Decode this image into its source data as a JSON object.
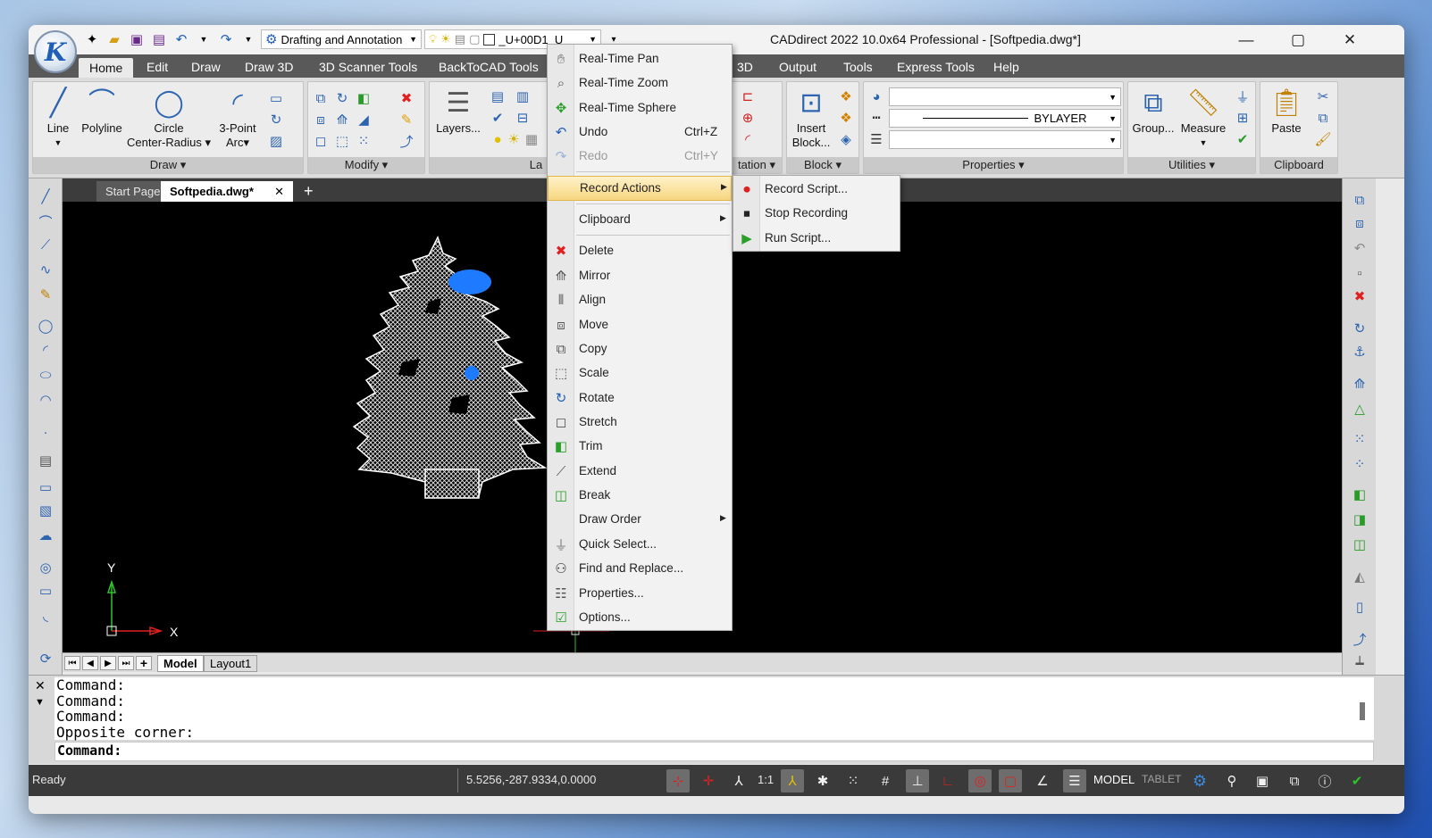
{
  "titlebar": {
    "title": "CADdirect 2022 10.0x64 Professional  - [Softpedia.dwg*]",
    "workspace": "Drafting and Annotation",
    "layer": "_U+00D1_U",
    "logo_icon": "caddirect-logo-icon"
  },
  "ribbon_tabs": [
    "Home",
    "Edit",
    "Draw",
    "Draw 3D",
    "3D Scanner Tools",
    "BackToCAD Tools",
    "3D",
    "Output",
    "Tools",
    "Express Tools",
    "Help"
  ],
  "ribbon": {
    "draw_panel": {
      "title": "Draw",
      "line": "Line",
      "polyline": "Polyline",
      "circle": "Circle",
      "circle_sub": "Center-Radius",
      "arc": "3-Point",
      "arc_sub": "Arc"
    },
    "modify_panel": {
      "title": "Modify"
    },
    "layers_panel": {
      "layers_btn": "Layers...",
      "title_partial": "La"
    },
    "annotation_partial": "tation",
    "block_panel": {
      "title": "Block",
      "insert": "Insert",
      "insert_sub": "Block..."
    },
    "properties_panel": {
      "title": "Properties",
      "linetype": "BYLAYER"
    },
    "utilities_panel": {
      "title": "Utilities",
      "group": "Group...",
      "measure": "Measure"
    },
    "clipboard_panel": {
      "title": "Clipboard",
      "paste": "Paste"
    }
  },
  "doc_tabs": {
    "start": "Start Page",
    "current": "Softpedia.dwg*"
  },
  "canvas": {
    "y_axis": "Y",
    "x_axis": "X"
  },
  "layout_tabs": [
    "Model",
    "Layout1"
  ],
  "command_history": [
    "Command:",
    "Command:",
    "Command:",
    "Opposite corner:"
  ],
  "command_prompt": "Command:",
  "status": {
    "ready": "Ready",
    "coords": "5.5256,-287.9334,0.0000",
    "scale": "1:1",
    "model": "MODEL",
    "tablet": "TABLET"
  },
  "context_menu": {
    "items": [
      {
        "label": "Real-Time Pan",
        "icon": "hand-pan-icon"
      },
      {
        "label": "Real-Time Zoom",
        "icon": "zoom-icon"
      },
      {
        "label": "Real-Time Sphere",
        "icon": "sphere-icon"
      },
      {
        "label": "Undo",
        "shortcut": "Ctrl+Z",
        "icon": "undo-icon"
      },
      {
        "label": "Redo",
        "shortcut": "Ctrl+Y",
        "icon": "redo-icon",
        "disabled": true
      },
      {
        "label": "Record Actions",
        "submenu": true
      },
      {
        "label": "Clipboard",
        "submenu": true
      },
      {
        "label": "Delete",
        "icon": "delete-icon"
      },
      {
        "label": "Mirror",
        "icon": "mirror-icon"
      },
      {
        "label": "Align",
        "icon": "align-icon"
      },
      {
        "label": "Move",
        "icon": "move-icon"
      },
      {
        "label": "Copy",
        "icon": "copy-icon"
      },
      {
        "label": "Scale",
        "icon": "scale-icon"
      },
      {
        "label": "Rotate",
        "icon": "rotate-icon"
      },
      {
        "label": "Stretch",
        "icon": "stretch-icon"
      },
      {
        "label": "Trim",
        "icon": "trim-icon"
      },
      {
        "label": "Extend",
        "icon": "extend-icon"
      },
      {
        "label": "Break",
        "icon": "break-icon"
      },
      {
        "label": "Draw Order",
        "submenu": true
      },
      {
        "label": "Quick Select...",
        "icon": "filter-icon"
      },
      {
        "label": "Find and Replace...",
        "icon": "binoculars-icon"
      },
      {
        "label": "Properties...",
        "icon": "properties-icon"
      },
      {
        "label": "Options...",
        "icon": "options-icon"
      }
    ],
    "submenu": [
      {
        "label": "Record Script...",
        "icon": "record-script-icon"
      },
      {
        "label": "Stop Recording",
        "icon": "stop-recording-icon"
      },
      {
        "label": "Run Script...",
        "icon": "run-script-icon"
      }
    ]
  },
  "colors": {
    "accent_blue": "#2d64b0",
    "delete_red": "#e02020",
    "highlight": "#f7d681"
  }
}
